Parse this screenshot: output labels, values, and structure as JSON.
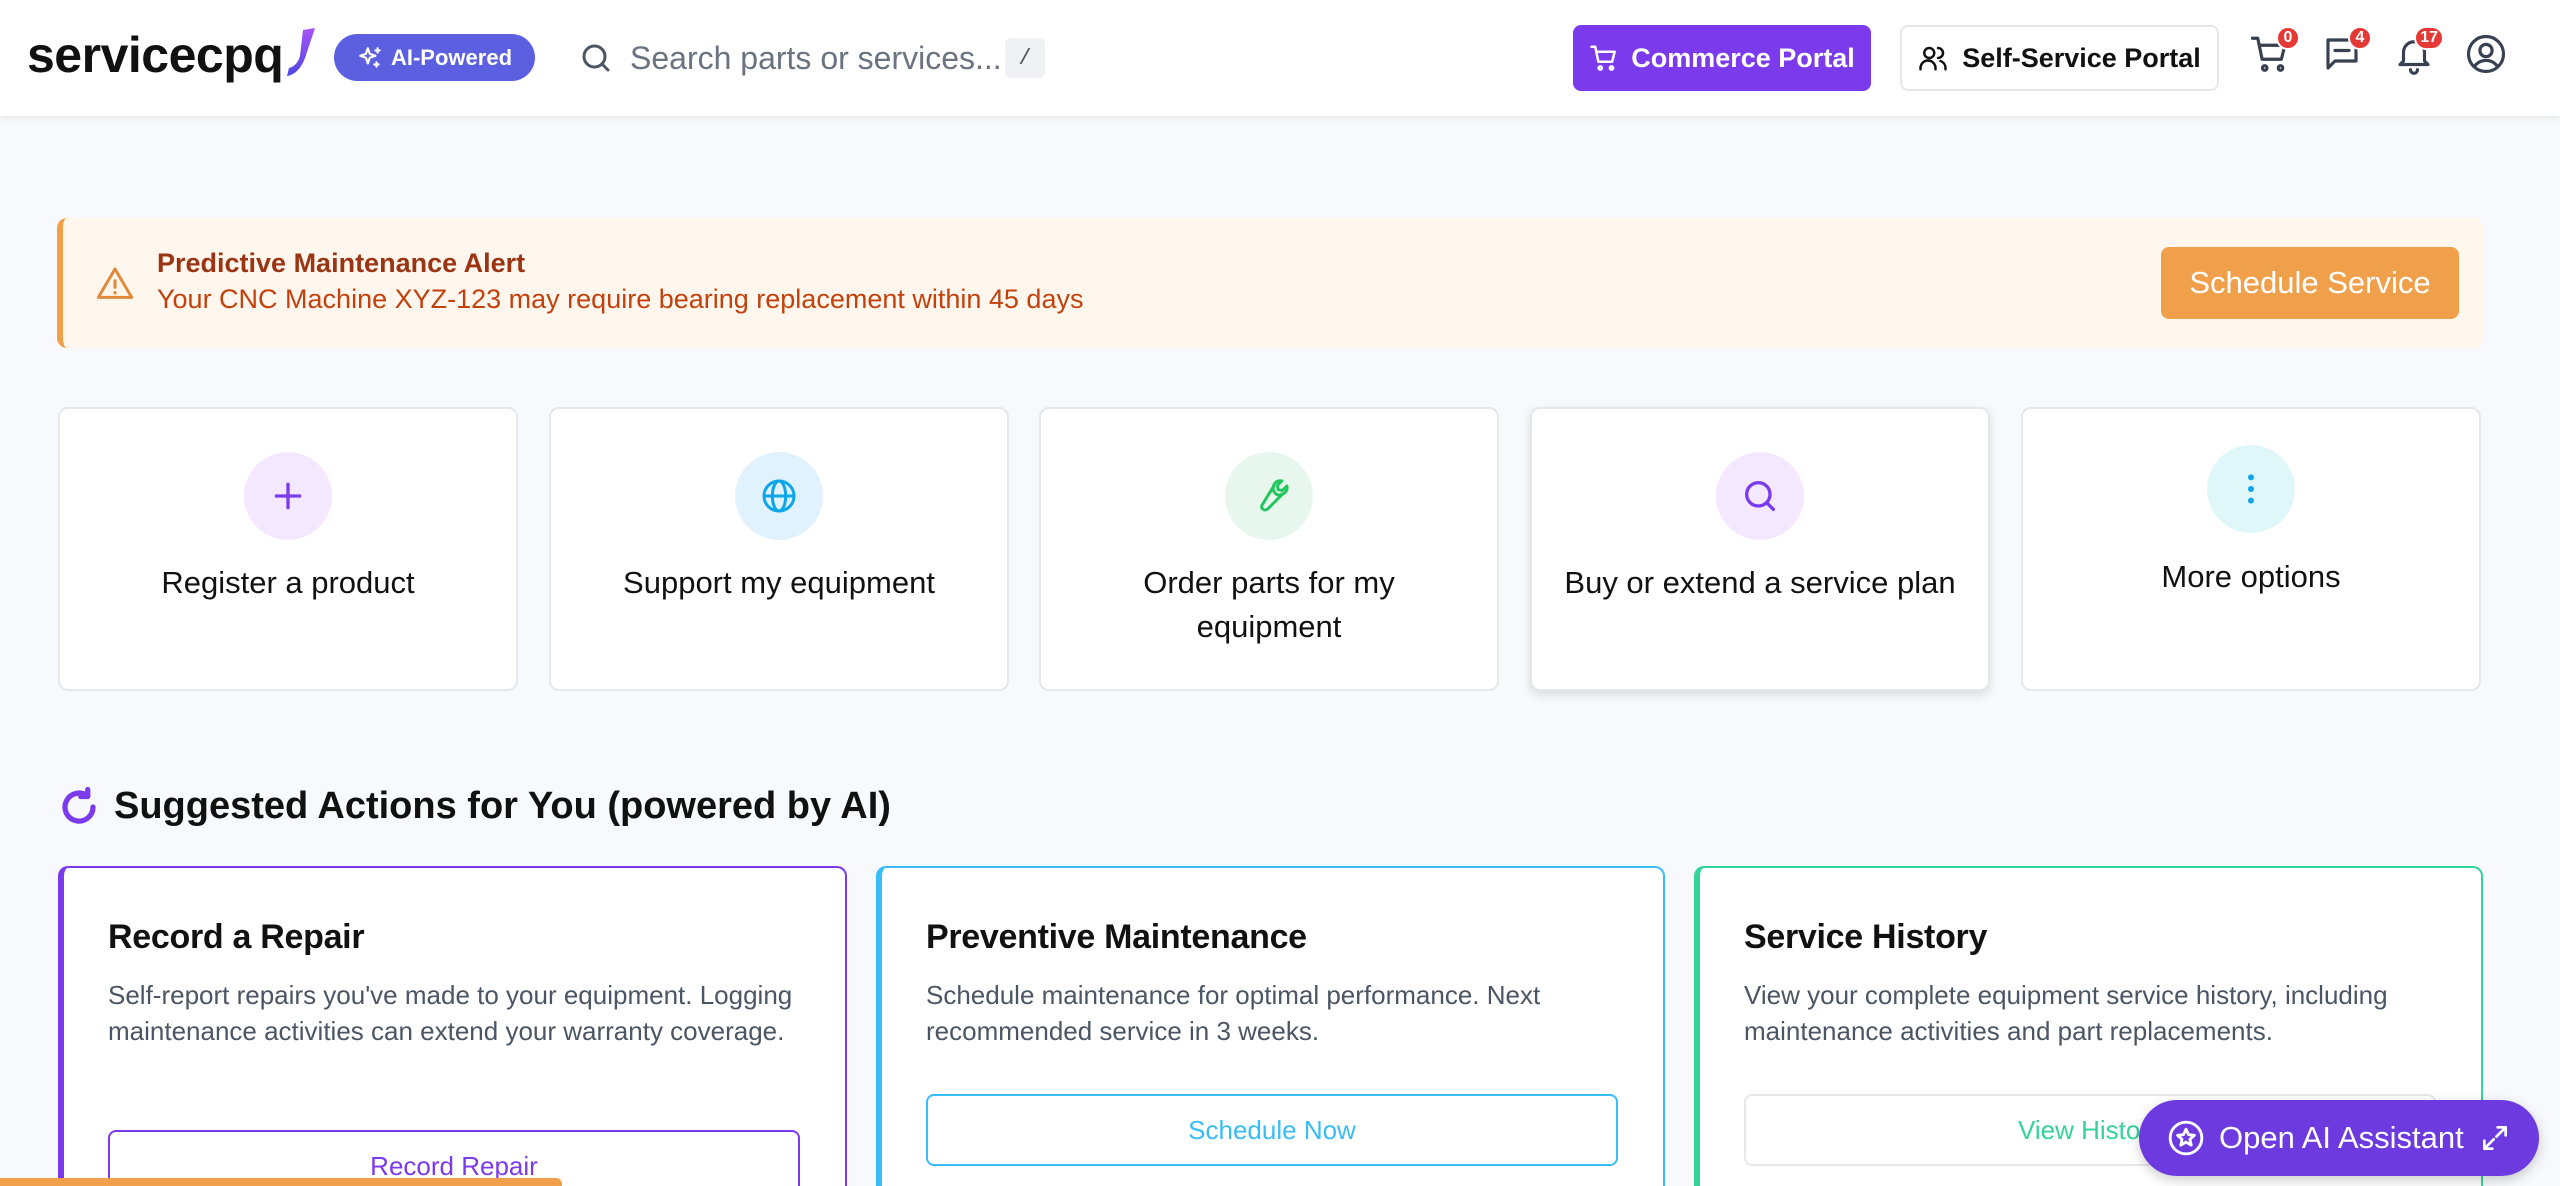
{
  "header": {
    "logo_text": "servicecpq",
    "ai_badge": "AI-Powered",
    "search_placeholder": "Search parts or services...",
    "search_shortcut": "/",
    "commerce_portal": "Commerce Portal",
    "self_service_portal": "Self-Service Portal",
    "cart_count": "0",
    "messages_count": "4",
    "notifications_count": "17"
  },
  "alert": {
    "title": "Predictive Maintenance Alert",
    "message": "Your CNC Machine XYZ-123 may require bearing replacement within 45 days",
    "button": "Schedule Service"
  },
  "tiles": [
    {
      "label": "Register a product",
      "icon": "plus-icon"
    },
    {
      "label": "Support my equipment",
      "icon": "globe-icon"
    },
    {
      "label": "Order parts for my equipment",
      "icon": "wrench-icon"
    },
    {
      "label": "Buy or extend a service plan",
      "icon": "search-icon"
    },
    {
      "label": "More options",
      "icon": "more-vertical-icon"
    }
  ],
  "suggested": {
    "heading": "Suggested Actions for You (powered by AI)",
    "cards": [
      {
        "title": "Record a Repair",
        "description": "Self-report repairs you've made to your equipment. Logging maintenance activities can extend your warranty coverage.",
        "button": "Record Repair",
        "color": "#7c3aed"
      },
      {
        "title": "Preventive Maintenance",
        "description": "Schedule maintenance for optimal performance. Next recommended service in 3 weeks.",
        "button": "Schedule Now",
        "color": "#38bdf8"
      },
      {
        "title": "Service History",
        "description": "View your complete equipment service history, including maintenance activities and part replacements.",
        "button": "View History",
        "color": "#34d399"
      }
    ]
  },
  "assistant": {
    "label": "Open AI Assistant"
  },
  "colors": {
    "primary": "#7c3aed",
    "ai_badge": "#5b5fe0",
    "alert_accent": "#f0a04b",
    "badge_red": "#e53935"
  }
}
